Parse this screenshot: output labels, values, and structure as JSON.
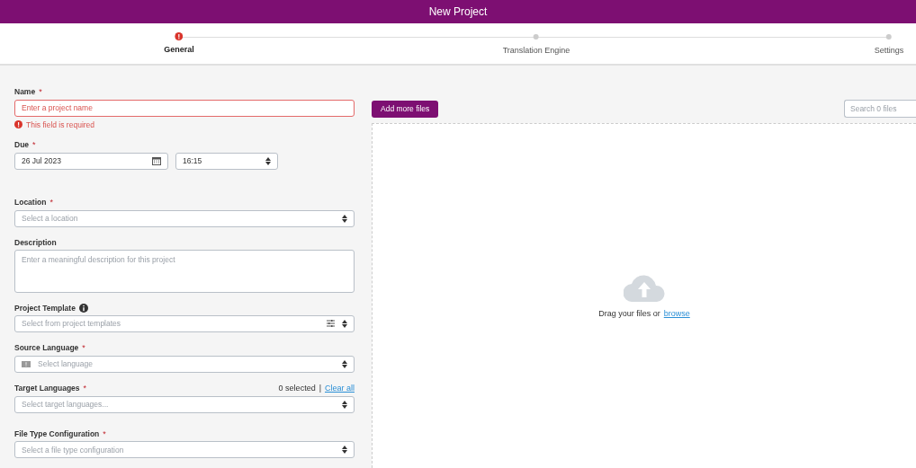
{
  "window": {
    "title": "New Project"
  },
  "steps": [
    {
      "label": "General",
      "selected": true,
      "error": true
    },
    {
      "label": "Translation Engine",
      "selected": false,
      "error": false
    },
    {
      "label": "Settings",
      "selected": false,
      "error": false
    }
  ],
  "fields": [
    {
      "kind": "text",
      "label": "Name",
      "required_mark": "*",
      "placeholder": "Enter a project name",
      "invalid": true,
      "error": "This field is required"
    },
    {
      "kind": "datetime",
      "label": "Due",
      "required_mark": "*",
      "date": "26 Jul 2023",
      "time": "16:15"
    },
    {
      "kind": "select",
      "label": "Location",
      "required_mark": "*",
      "placeholder": "Select a location"
    },
    {
      "kind": "textarea",
      "label": "Description",
      "placeholder": "Enter a meaningful description for this project"
    },
    {
      "kind": "template",
      "label": "Project Template",
      "placeholder": "Select from project templates"
    },
    {
      "kind": "language",
      "label": "Source Language",
      "required_mark": "*",
      "placeholder": "Select language"
    },
    {
      "kind": "multi",
      "label": "Target Languages",
      "required_mark": "*",
      "placeholder": "Select target languages...",
      "count": "0 selected",
      "separator": "|",
      "clear": "Clear all"
    },
    {
      "kind": "select",
      "label": "File Type Configuration",
      "required_mark": "*",
      "placeholder": "Select a file type configuration"
    }
  ],
  "files": {
    "add_button": "Add more files",
    "search_placeholder": "Search 0 files",
    "drop_text": "Drag your files or",
    "browse": "browse"
  }
}
